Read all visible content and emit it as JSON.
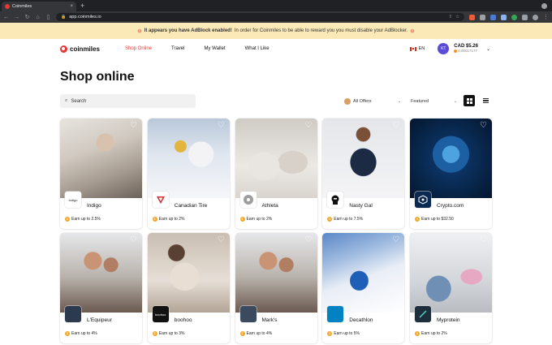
{
  "browser": {
    "tab_title": "Coinmiles",
    "tab_close": "×",
    "new_tab": "+",
    "url": "app.coinmiles.io"
  },
  "adbanner": {
    "bold_text": "It appears you have AdBlock enabled!",
    "text": "In order for Coinmiles to be able to reward you you must disable your AdBlocker."
  },
  "header": {
    "logo": "coinmiles",
    "nav": [
      {
        "label": "Shop Online",
        "active": true
      },
      {
        "label": "Travel"
      },
      {
        "label": "My Wallet"
      },
      {
        "label": "What I Like"
      }
    ],
    "language": "EN",
    "avatar_initials": "KT",
    "balance_cad": "CAD $5.26",
    "balance_btc": "0.00017177"
  },
  "page_title": "Shop online",
  "filters": {
    "search_placeholder": "Search",
    "offers_label": "All Offers",
    "sort_label": "Featured"
  },
  "colors": {
    "accent": "#e53935",
    "banner": "#fbe9b7",
    "earn_coin": "#f5a623"
  },
  "cards": [
    {
      "name": "Indigo",
      "logo_text": "Indigo",
      "earn": "Earn up to 2.5%"
    },
    {
      "name": "Canadian Tire",
      "logo_text": "",
      "earn": "Earn up to 2%"
    },
    {
      "name": "Athleta",
      "logo_text": "",
      "earn": "Earn up to 2%"
    },
    {
      "name": "Nasty Gal",
      "logo_text": "",
      "earn": "Earn up to 7.5%"
    },
    {
      "name": "Crypto.com",
      "logo_text": "",
      "earn": "Earn up to $32.50"
    },
    {
      "name": "L'Equipeur",
      "logo_text": "",
      "earn": "Earn up to 4%"
    },
    {
      "name": "boohoo",
      "logo_text": "boohoo",
      "earn": "Earn up to 3%"
    },
    {
      "name": "Mark's",
      "logo_text": "",
      "earn": "Earn up to 4%"
    },
    {
      "name": "Decathlon",
      "logo_text": "",
      "earn": "Earn up to 5%"
    },
    {
      "name": "Myprotein",
      "logo_text": "",
      "earn": "Earn up to 2%"
    }
  ]
}
